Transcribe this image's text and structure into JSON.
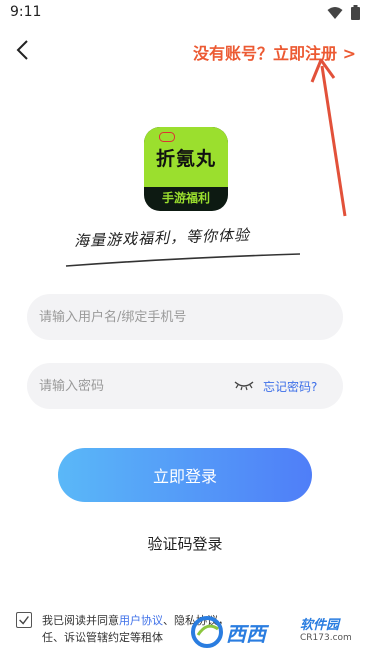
{
  "status": {
    "time": "9:11"
  },
  "header": {
    "register_link": "没有账号？立即注册 >"
  },
  "app": {
    "logo_name": "折氪丸",
    "logo_sub": "手游福利",
    "slogan": "海量游戏福利，等你体验"
  },
  "form": {
    "username_placeholder": "请输入用户名/绑定手机号",
    "password_placeholder": "请输入密码",
    "forgot_label": "忘记密码?",
    "login_label": "立即登录",
    "code_login_label": "验证码登录"
  },
  "agreement": {
    "prefix": "我已阅读并同意",
    "user_protocol": "用户协议",
    "middle": "、隐私协议，",
    "line2": "任、诉讼管辖约定等租体"
  },
  "watermark": {
    "brand": "西西",
    "sub": "软件园",
    "url": "CR173.com"
  },
  "colors": {
    "accent": "#ec5a33",
    "link": "#3d6fe8",
    "button_start": "#5ab8f8",
    "button_end": "#4f7ef8",
    "logo_green": "#9bdf2e"
  }
}
